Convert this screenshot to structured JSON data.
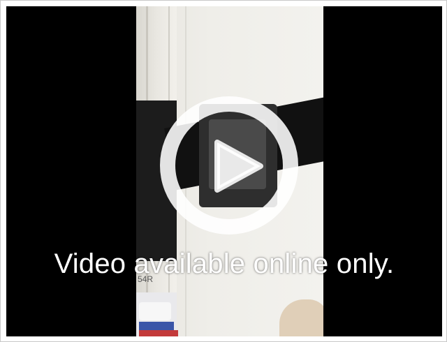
{
  "player": {
    "caption": "Video available online only.",
    "play_icon": "play-icon",
    "still": {
      "label_text": "54R"
    }
  },
  "colors": {
    "background": "#000000",
    "overlay": "#ffffff"
  }
}
